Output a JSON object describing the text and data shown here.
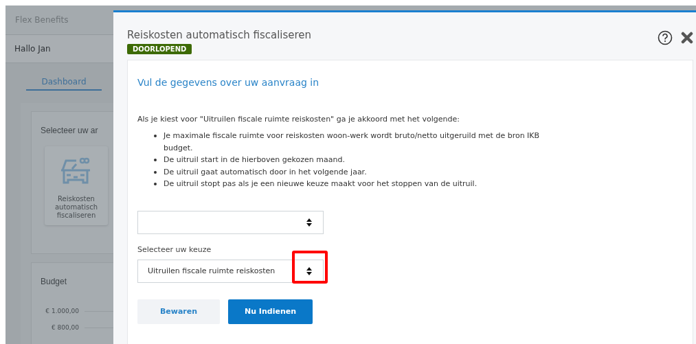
{
  "background": {
    "app_title": "Flex Benefits",
    "greeting": "Hallo Jan",
    "tabs": [
      {
        "label": "Dashboard",
        "selected": true
      }
    ],
    "selection_card": {
      "title": "Selecteer uw ar",
      "tile_label": "Reiskosten automatisch fiscaliseren"
    },
    "budget_card": {
      "title": "Budget",
      "axis_labels": [
        "€ 1.000,00",
        "€ 800,00"
      ]
    }
  },
  "modal": {
    "title": "Reiskosten automatisch fiscaliseren",
    "status_badge": "DOORLOPEND",
    "heading": "Vul de gegevens over uw aanvraag in",
    "intro": "Als je kiest voor \"Uitruilen fiscale ruimte reiskosten\" ga je akkoord met het volgende:",
    "bullets": [
      "Je maximale fiscale ruimte voor reiskosten woon-werk wordt bruto/netto uitgeruild met de bron IKB budget.",
      "De uitruil start in de hierboven gekozen maand.",
      "De uitruil gaat automatisch door in het volgende jaar.",
      "De uitruil stopt pas als je een nieuwe keuze maakt voor het stoppen van de uitruil."
    ],
    "selects": [
      {
        "highlighted": false
      },
      {
        "label": "Selecteer uw keuze",
        "value": "Uitruilen fiscale ruimte reiskosten",
        "highlighted": true
      }
    ],
    "buttons": [
      {
        "label": "Bewaren",
        "kind": "secondary"
      },
      {
        "label": "Nu Indienen",
        "kind": "primary"
      }
    ]
  }
}
